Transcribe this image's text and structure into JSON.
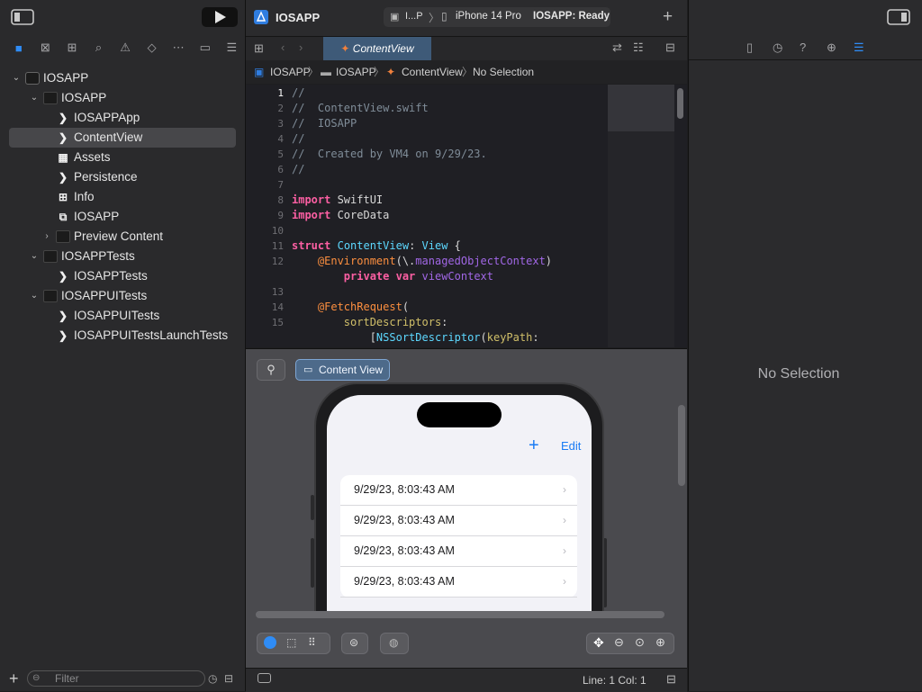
{
  "window": {
    "project_name": "IOSAPP"
  },
  "toolbar": {
    "scheme": "I...P",
    "device": "iPhone 14 Pro",
    "status": "IOSAPP: Ready",
    "play_icon": "play-icon",
    "add_icon": "plus-icon"
  },
  "navigator": {
    "tree": [
      {
        "label": "IOSAPP",
        "icon": "project-icon",
        "level": 0,
        "disclosure": "open"
      },
      {
        "label": "IOSAPP",
        "icon": "folder-icon",
        "level": 1,
        "disclosure": "open"
      },
      {
        "label": "IOSAPPApp",
        "icon": "swift-file-icon",
        "level": 2
      },
      {
        "label": "ContentView",
        "icon": "swift-file-icon",
        "level": 2,
        "selected": true
      },
      {
        "label": "Assets",
        "icon": "asset-catalog-icon",
        "level": 2
      },
      {
        "label": "Persistence",
        "icon": "swift-file-icon",
        "level": 2
      },
      {
        "label": "Info",
        "icon": "plist-icon",
        "level": 2
      },
      {
        "label": "IOSAPP",
        "icon": "data-model-icon",
        "level": 2
      },
      {
        "label": "Preview Content",
        "icon": "folder-icon",
        "level": 2,
        "disclosure": "closed"
      },
      {
        "label": "IOSAPPTests",
        "icon": "folder-icon",
        "level": 1,
        "disclosure": "open"
      },
      {
        "label": "IOSAPPTests",
        "icon": "swift-file-icon",
        "level": 2
      },
      {
        "label": "IOSAPPUITests",
        "icon": "folder-icon",
        "level": 1,
        "disclosure": "open"
      },
      {
        "label": "IOSAPPUITests",
        "icon": "swift-file-icon",
        "level": 2
      },
      {
        "label": "IOSAPPUITestsLaunchTests",
        "icon": "swift-file-icon",
        "level": 2
      }
    ],
    "filter_placeholder": "Filter"
  },
  "editor": {
    "tab_label": "ContentView",
    "breadcrumb": [
      "IOSAPP",
      "IOSAPP",
      "ContentView",
      "No Selection"
    ],
    "current_line": 1,
    "code_lines": [
      {
        "n": "1",
        "t": "//"
      },
      {
        "n": "2",
        "t": "//  ContentView.swift"
      },
      {
        "n": "3",
        "t": "//  IOSAPP"
      },
      {
        "n": "4",
        "t": "//"
      },
      {
        "n": "5",
        "t": "//  Created by VM4 on 9/29/23."
      },
      {
        "n": "6",
        "t": "//"
      },
      {
        "n": "7",
        "t": ""
      },
      {
        "n": "8",
        "t": "import SwiftUI"
      },
      {
        "n": "9",
        "t": "import CoreData"
      },
      {
        "n": "10",
        "t": ""
      },
      {
        "n": "11",
        "t": "struct ContentView: View {"
      },
      {
        "n": "12",
        "t": "    @Environment(\\.managedObjectContext)"
      },
      {
        "n": "",
        "t": "        private var viewContext"
      },
      {
        "n": "13",
        "t": ""
      },
      {
        "n": "14",
        "t": "    @FetchRequest("
      },
      {
        "n": "15",
        "t": "        sortDescriptors:"
      },
      {
        "n": "",
        "t": "            [NSSortDescriptor(keyPath:"
      }
    ]
  },
  "preview": {
    "chip_label": "Content View",
    "edit_label": "Edit",
    "items": [
      "9/29/23, 8:03:43 AM",
      "9/29/23, 8:03:43 AM",
      "9/29/23, 8:03:43 AM",
      "9/29/23, 8:03:43 AM"
    ]
  },
  "status_bar": {
    "position": "Line: 1  Col: 1"
  },
  "inspector": {
    "empty_label": "No Selection"
  },
  "colors": {
    "accent": "#2f8cf5",
    "tab_active": "#3e5a78",
    "ios_blue": "#1a7cf4"
  }
}
